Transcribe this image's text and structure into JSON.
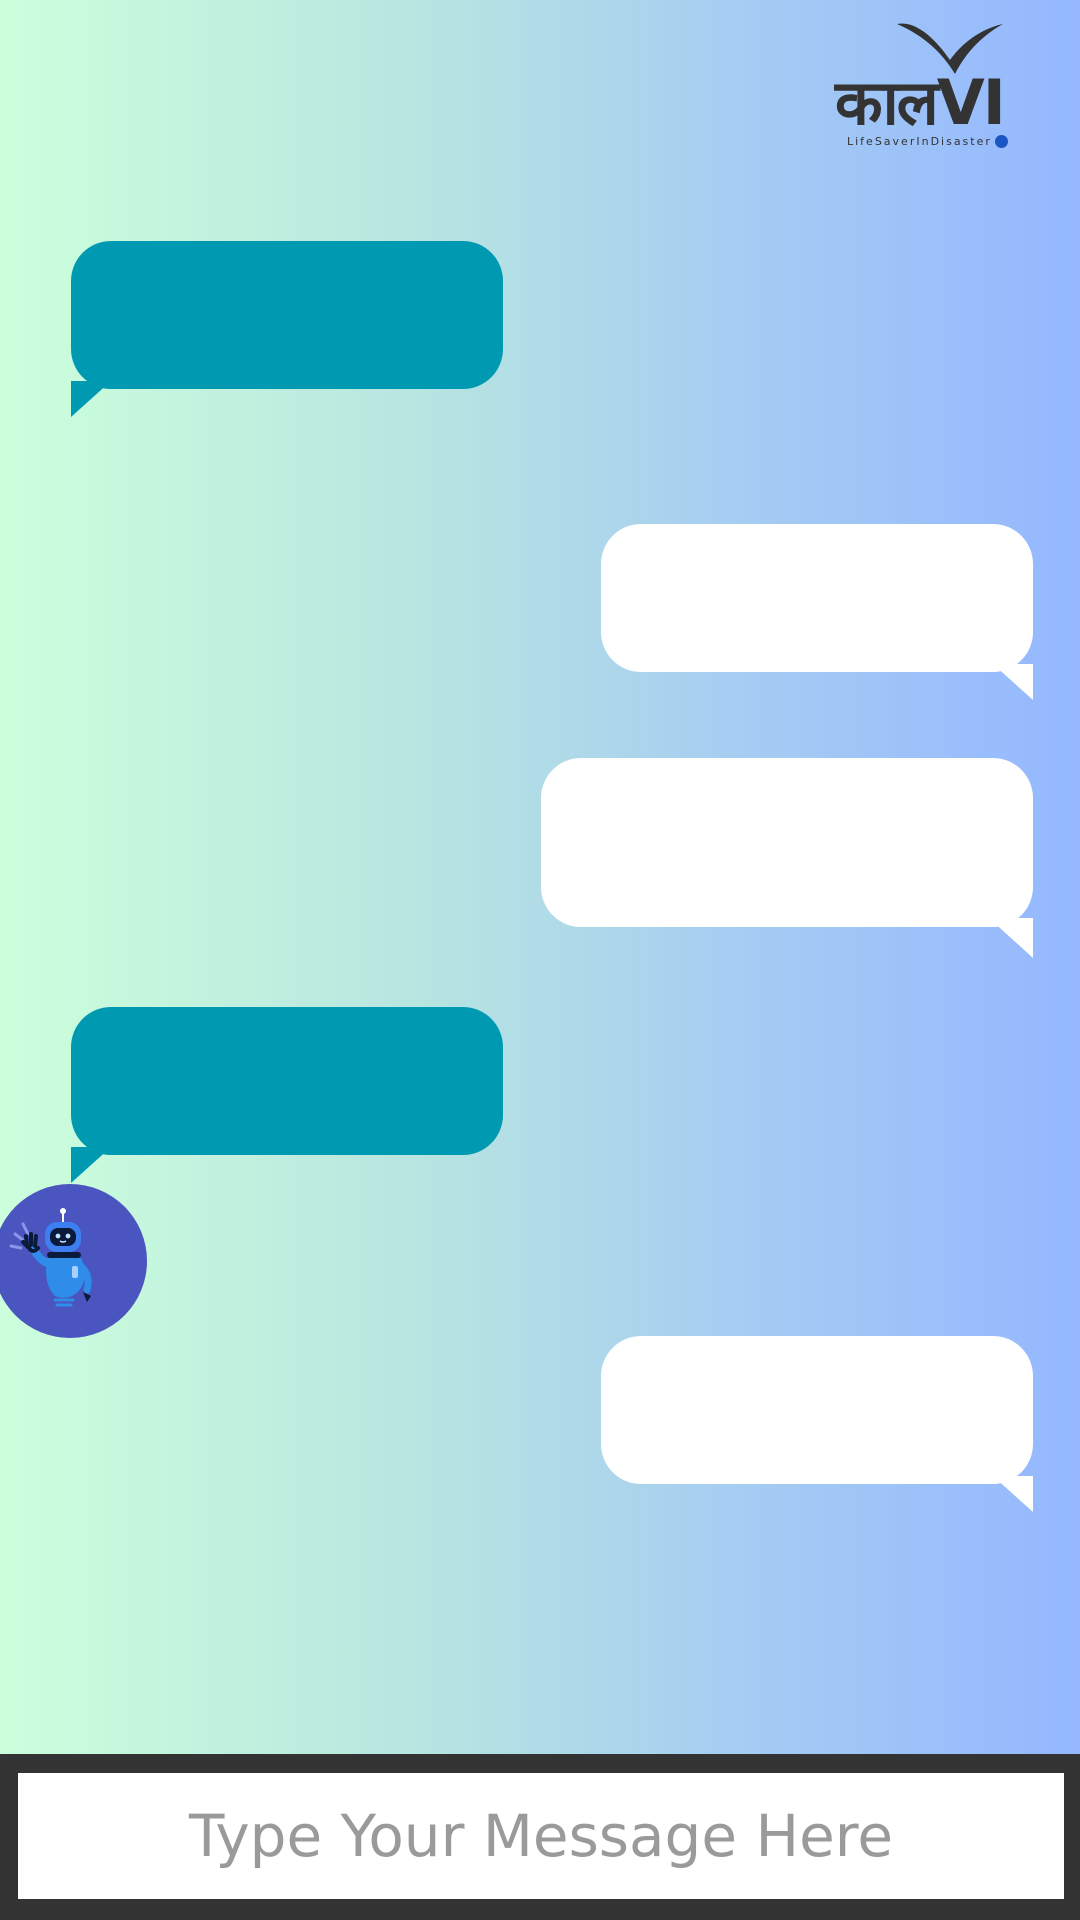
{
  "app": {
    "logo": {
      "wordmark": "कालVI",
      "tagline": "LifeSaverInDisaster",
      "dot_color": "#1a56c4",
      "ink_color": "#333333",
      "bird_icon": "bird-icon"
    }
  },
  "colors": {
    "background_left": "#ccffdc",
    "background_right": "#94b7ff",
    "bot_bubble": "#0099b2",
    "user_bubble": "#ffffff",
    "avatar_bg": "#4a55bf",
    "input_bar": "#333333"
  },
  "messages": [
    {
      "sender": "bot",
      "text": ""
    },
    {
      "sender": "user",
      "text": ""
    },
    {
      "sender": "user",
      "text": ""
    },
    {
      "sender": "bot",
      "text": ""
    },
    {
      "sender": "user",
      "text": ""
    }
  ],
  "avatar": {
    "icon": "robot-waving-icon"
  },
  "composer": {
    "placeholder": "Type Your Message Here",
    "value": ""
  }
}
